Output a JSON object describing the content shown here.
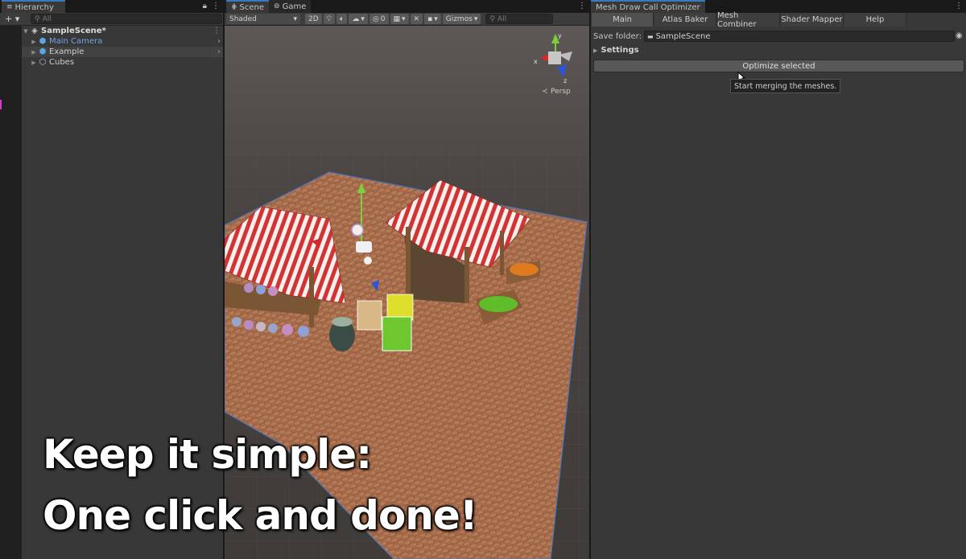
{
  "hierarchy": {
    "tab_label": "Hierarchy",
    "search_placeholder": "All",
    "add_label": "+ ▾",
    "scene_name": "SampleScene*",
    "items": [
      {
        "label": "Main Camera"
      },
      {
        "label": "Example"
      },
      {
        "label": "Cubes"
      }
    ]
  },
  "scene_view": {
    "tabs": [
      {
        "label": "Scene"
      },
      {
        "label": "Game"
      }
    ],
    "shading_mode": "Shaded",
    "mode_2d": "2D",
    "hidden_count": "0",
    "gizmos_label": "Gizmos",
    "search_placeholder": "All",
    "persp_label": "Persp",
    "gizmo_axes": {
      "x": "x",
      "y": "y",
      "z": "z"
    }
  },
  "optimizer": {
    "window_title": "Mesh Draw Call Optimizer",
    "tabs": [
      {
        "label": "Main"
      },
      {
        "label": "Atlas Baker"
      },
      {
        "label": "Mesh Combiner"
      },
      {
        "label": "Shader Mapper"
      },
      {
        "label": "Help"
      }
    ],
    "save_folder_label": "Save folder:",
    "save_folder_value": "SampleScene",
    "settings_label": "Settings",
    "optimize_button": "Optimize selected",
    "tooltip": "Start merging the meshes."
  },
  "caption": {
    "line1": "Keep it simple:",
    "line2": "One click and done!"
  },
  "colors": {
    "accent": "#3a79bb",
    "camera_text": "#6fa3e8",
    "panel": "#383838"
  }
}
